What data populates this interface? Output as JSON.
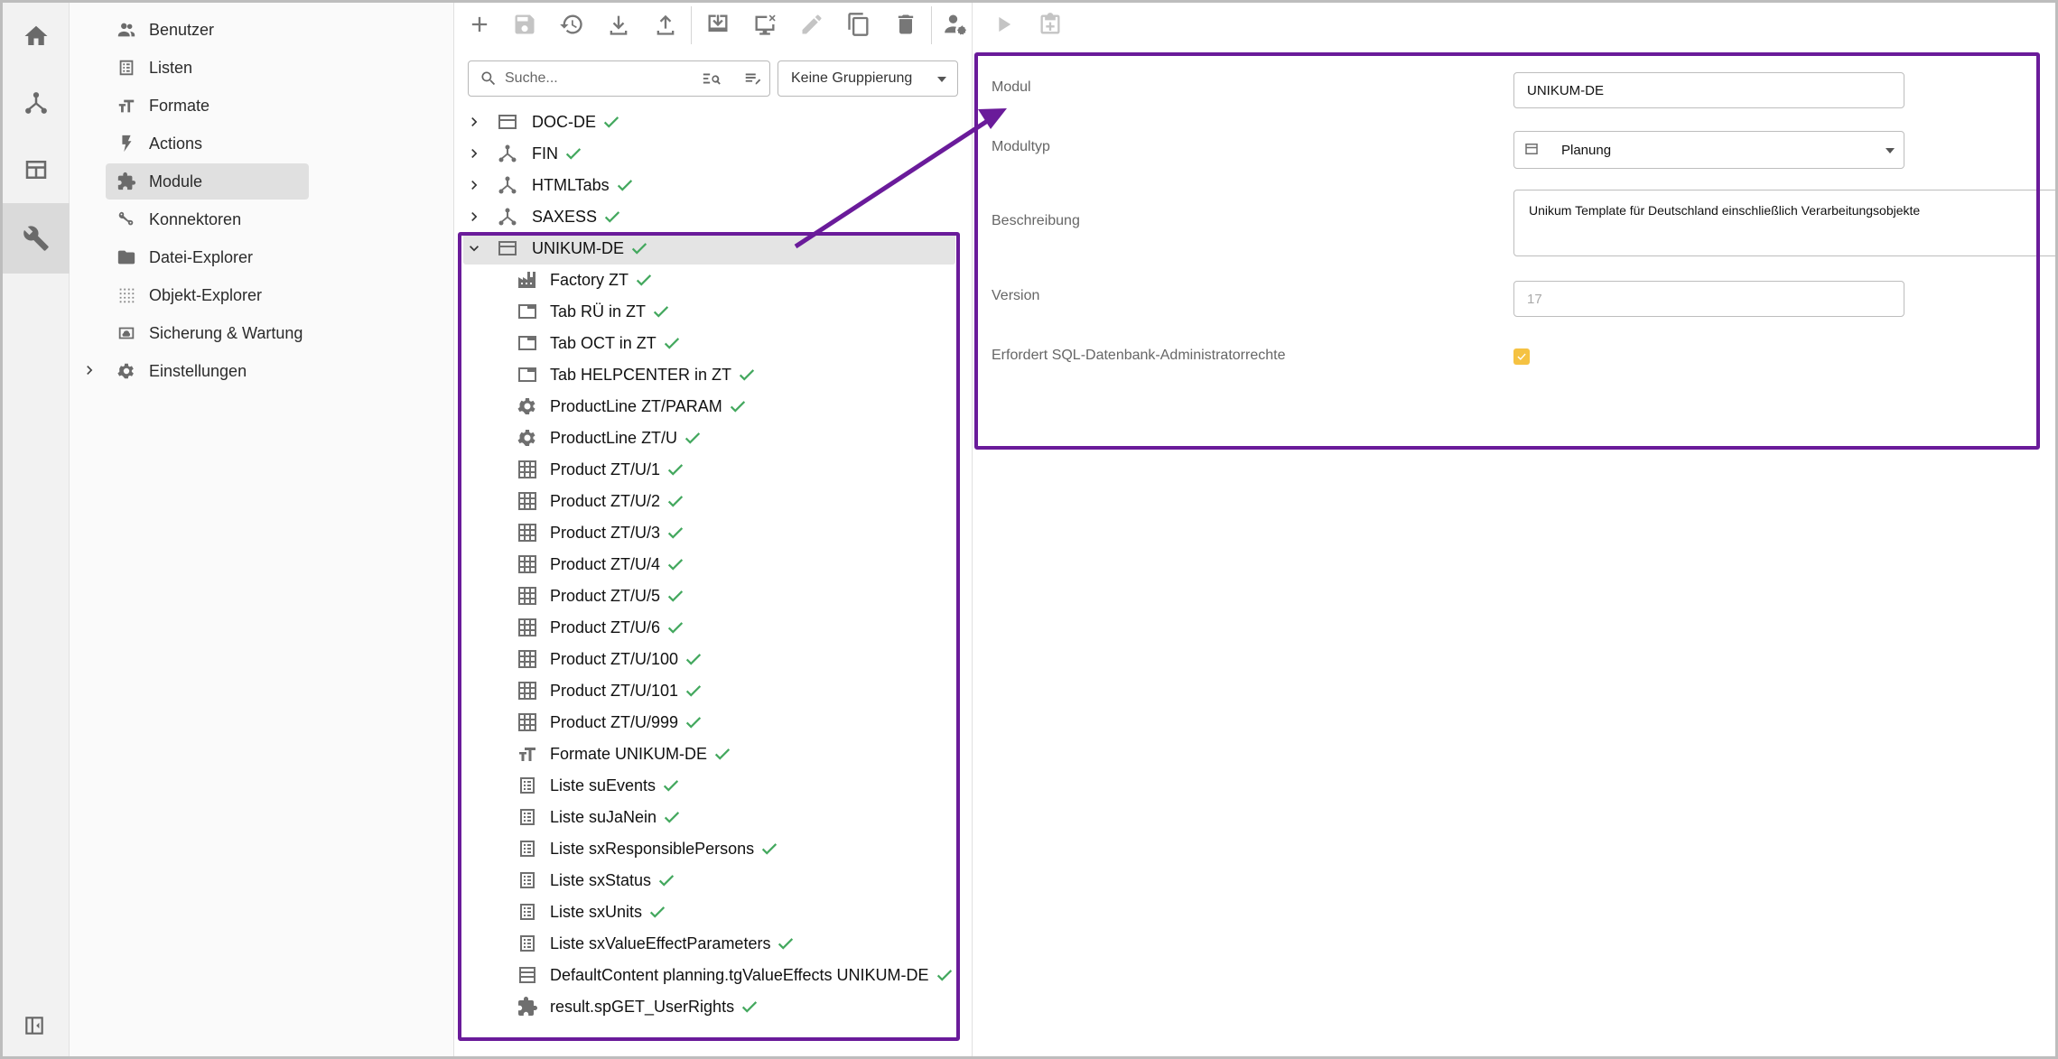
{
  "nav": {
    "items": [
      {
        "label": "Benutzer",
        "icon": "users-icon"
      },
      {
        "label": "Listen",
        "icon": "list-icon"
      },
      {
        "label": "Formate",
        "icon": "text-format-icon"
      },
      {
        "label": "Actions",
        "icon": "bolt-icon"
      },
      {
        "label": "Module",
        "icon": "puzzle-icon",
        "active": true
      },
      {
        "label": "Konnektoren",
        "icon": "connector-icon"
      },
      {
        "label": "Datei-Explorer",
        "icon": "folder-icon"
      },
      {
        "label": "Objekt-Explorer",
        "icon": "dots-grid-icon"
      },
      {
        "label": "Sicherung & Wartung",
        "icon": "backup-icon"
      },
      {
        "label": "Einstellungen",
        "icon": "gear-icon",
        "expandable": true
      }
    ]
  },
  "search": {
    "placeholder": "Suche..."
  },
  "grouping": {
    "value": "Keine Gruppierung"
  },
  "tree": {
    "roots": [
      {
        "label": "DOC-DE",
        "icon": "window-icon"
      },
      {
        "label": "FIN",
        "icon": "hierarchy-icon"
      },
      {
        "label": "HTMLTabs",
        "icon": "hierarchy-icon"
      },
      {
        "label": "SAXESS",
        "icon": "hierarchy-icon"
      },
      {
        "label": "UNIKUM-DE",
        "icon": "window-icon",
        "expanded": true,
        "selected": true
      }
    ],
    "children": [
      {
        "label": "Factory ZT",
        "icon": "factory-icon"
      },
      {
        "label": "Tab RÜ in ZT",
        "icon": "tab-icon"
      },
      {
        "label": "Tab OCT in ZT",
        "icon": "tab-icon"
      },
      {
        "label": "Tab HELPCENTER in ZT",
        "icon": "tab-icon"
      },
      {
        "label": "ProductLine ZT/PARAM",
        "icon": "gear-icon"
      },
      {
        "label": "ProductLine ZT/U",
        "icon": "gear-icon"
      },
      {
        "label": "Product ZT/U/1",
        "icon": "grid-icon"
      },
      {
        "label": "Product ZT/U/2",
        "icon": "grid-icon"
      },
      {
        "label": "Product ZT/U/3",
        "icon": "grid-icon"
      },
      {
        "label": "Product ZT/U/4",
        "icon": "grid-icon"
      },
      {
        "label": "Product ZT/U/5",
        "icon": "grid-icon"
      },
      {
        "label": "Product ZT/U/6",
        "icon": "grid-icon"
      },
      {
        "label": "Product ZT/U/100",
        "icon": "grid-icon"
      },
      {
        "label": "Product ZT/U/101",
        "icon": "grid-icon"
      },
      {
        "label": "Product ZT/U/999",
        "icon": "grid-icon"
      },
      {
        "label": "Formate UNIKUM-DE",
        "icon": "text-format-icon"
      },
      {
        "label": "Liste suEvents",
        "icon": "list-icon"
      },
      {
        "label": "Liste suJaNein",
        "icon": "list-icon"
      },
      {
        "label": "Liste sxResponsiblePersons",
        "icon": "list-icon"
      },
      {
        "label": "Liste sxStatus",
        "icon": "list-icon"
      },
      {
        "label": "Liste sxUnits",
        "icon": "list-icon"
      },
      {
        "label": "Liste sxValueEffectParameters",
        "icon": "list-icon"
      },
      {
        "label": "DefaultContent planning.tgValueEffects UNIKUM-DE",
        "icon": "table-icon"
      },
      {
        "label": "result.spGET_UserRights",
        "icon": "puzzle-icon"
      }
    ]
  },
  "form": {
    "modul_label": "Modul",
    "modul_value": "UNIKUM-DE",
    "modultyp_label": "Modultyp",
    "modultyp_value": "Planung",
    "beschreibung_label": "Beschreibung",
    "beschreibung_value": "Unikum Template für Deutschland einschließlich Verarbeitungsobjekte",
    "version_label": "Version",
    "version_value": "17",
    "sql_label": "Erfordert SQL-Datenbank-Administratorrechte",
    "sql_checked": true
  },
  "colors": {
    "highlight": "#6a1b9a",
    "check": "#43a85e",
    "checkbox": "#f5c242"
  }
}
